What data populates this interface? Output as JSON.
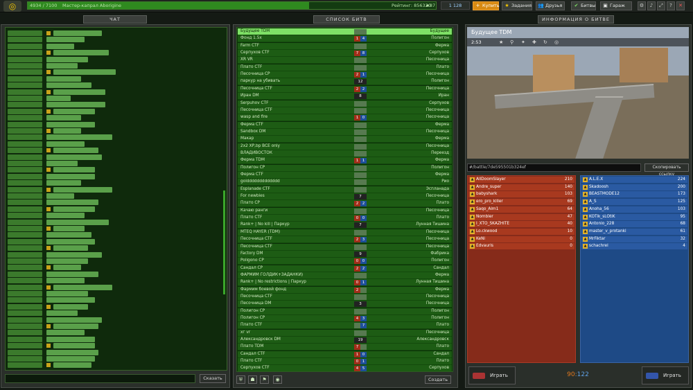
{
  "topbar": {
    "rank_progress_text": "4934 / 7100",
    "rank_name": "Мастер-капрал Aborigine",
    "rank_progress": 0.69,
    "rating_text": "Рейтинг: 856320",
    "rating_star": "★87",
    "crystals": "1 128",
    "buy_label": "Купить",
    "missions_label": "Задания",
    "friends_label": "Друзья",
    "battles_label": "Битвы",
    "garage_label": "Гараж"
  },
  "chat": {
    "title": "ЧАТ",
    "send_label": "Сказать"
  },
  "battles": {
    "title": "СПИСОК БИТВ",
    "create_label": "Создать",
    "rows": [
      {
        "name": "Будущее TDM",
        "map": "Будущее",
        "red": "",
        "blue": "",
        "mode": "team",
        "selected": true
      },
      {
        "name": "Фонд 1.5x",
        "map": "Полигон",
        "red": "1",
        "blue": "4",
        "mode": "team"
      },
      {
        "name": "Farm CTF",
        "map": "Ферма",
        "red": "",
        "blue": "",
        "mode": "team"
      },
      {
        "name": "Серпухов CTF",
        "map": "Серпухов",
        "red": "7",
        "blue": "8",
        "mode": "team"
      },
      {
        "name": "XR VR",
        "map": "Песочница",
        "red": "",
        "blue": "",
        "mode": "team"
      },
      {
        "name": "Плато CTF",
        "map": "Плато",
        "red": "",
        "blue": "",
        "mode": "team"
      },
      {
        "name": "Песочница CP",
        "map": "Песочница",
        "red": "2",
        "blue": "1",
        "mode": "team"
      },
      {
        "name": "паркур на убивать",
        "map": "Полигон",
        "dm": "12",
        "mode": "dm"
      },
      {
        "name": "Песочница CTF",
        "map": "Песочница",
        "red": "2",
        "blue": "2",
        "mode": "team"
      },
      {
        "name": "Иран DM",
        "map": "Иран",
        "dm": "8",
        "mode": "dm"
      },
      {
        "name": "Serpuhov CTF",
        "map": "Серпухов",
        "red": "",
        "blue": "",
        "mode": "team"
      },
      {
        "name": "Песочница CTF",
        "map": "Песочница",
        "red": "",
        "blue": "",
        "mode": "team"
      },
      {
        "name": "wasp and fire",
        "map": "Песочница",
        "red": "1",
        "blue": "0",
        "mode": "team"
      },
      {
        "name": "Ферма CTF",
        "map": "Ферма",
        "red": "",
        "blue": "",
        "mode": "team"
      },
      {
        "name": "Sandbox DM",
        "map": "Песочница",
        "dm": "",
        "mode": "dm"
      },
      {
        "name": "Макар",
        "map": "Ферма",
        "red": "",
        "blue": "",
        "mode": "team"
      },
      {
        "name": "2x2 XP,bp ВСЕ only",
        "map": "Песочница",
        "red": "",
        "blue": "",
        "mode": "team"
      },
      {
        "name": "ВЛАДИВОСТОК",
        "map": "Переезд",
        "red": "",
        "blue": "",
        "mode": "team"
      },
      {
        "name": "Ферма TDM",
        "map": "Ферма",
        "red": "1",
        "blue": "1",
        "mode": "team"
      },
      {
        "name": "Полигон CP",
        "map": "Полигон",
        "red": "",
        "blue": "",
        "mode": "team"
      },
      {
        "name": "Ферма CTF",
        "map": "Ферма",
        "red": "",
        "blue": "",
        "mode": "team"
      },
      {
        "name": "golddddddddddddd",
        "map": "Рио",
        "dm": "",
        "mode": "dm"
      },
      {
        "name": "Esplanade CTF",
        "map": "Эспланада",
        "red": "",
        "blue": "",
        "mode": "team"
      },
      {
        "name": "For newbies",
        "map": "Песочница",
        "dm": "7",
        "mode": "dm"
      },
      {
        "name": "Плато CP",
        "map": "Плато",
        "red": "2",
        "blue": "2",
        "mode": "team"
      },
      {
        "name": "Качаю ранги",
        "map": "Песочница",
        "red": "",
        "blue": "",
        "mode": "team"
      },
      {
        "name": "Плато CTF",
        "map": "Плато",
        "red": "0",
        "blue": "0",
        "mode": "team"
      },
      {
        "name": "Rank+ | No kill | Паркур",
        "map": "Лунная Тишина",
        "dm": "7",
        "mode": "dm"
      },
      {
        "name": "MTEQ HAYER (TDM)",
        "map": "Песочница",
        "red": "",
        "blue": "",
        "mode": "team"
      },
      {
        "name": "Песочница CTF",
        "map": "Песочница",
        "red": "2",
        "blue": "3",
        "mode": "team"
      },
      {
        "name": "Песочница CTF",
        "map": "Песочница",
        "red": "",
        "blue": "",
        "mode": "team"
      },
      {
        "name": "Factory DM",
        "map": "Фабрика",
        "dm": "9",
        "mode": "dm"
      },
      {
        "name": "Poligono CP",
        "map": "Полигон",
        "red": "0",
        "blue": "0",
        "mode": "team"
      },
      {
        "name": "Сандал CP",
        "map": "Сандал",
        "red": "2",
        "blue": "2",
        "mode": "team"
      },
      {
        "name": "ФАРМИМ ГОЛДИК+ЗАДАНКИ)",
        "map": "Ферма",
        "red": "",
        "blue": "",
        "mode": "team"
      },
      {
        "name": "Rank+ | No restrictions | Паркур",
        "map": "Лунная Тишина",
        "red": "0",
        "blue": "1",
        "mode": "team"
      },
      {
        "name": "Фармим боевой фонд",
        "map": "Ферма",
        "red": "2",
        "blue": "",
        "mode": "team"
      },
      {
        "name": "Песочница CTF",
        "map": "Песочница",
        "red": "",
        "blue": "",
        "mode": "team"
      },
      {
        "name": "Песочница DM",
        "map": "Песочница",
        "dm": "3",
        "mode": "dm"
      },
      {
        "name": "Полигон CP",
        "map": "Полигон",
        "red": "",
        "blue": "",
        "mode": "team"
      },
      {
        "name": "Полигон CP",
        "map": "Полигон",
        "red": "4",
        "blue": "3",
        "mode": "team"
      },
      {
        "name": "Плато CTF",
        "map": "Плато",
        "red": "",
        "blue": "7",
        "mode": "team"
      },
      {
        "name": "хг vr",
        "map": "Песочница",
        "red": "",
        "blue": "",
        "mode": "team"
      },
      {
        "name": "Александровск DM",
        "map": "Александровск",
        "dm": "19",
        "mode": "dm"
      },
      {
        "name": "Плато TDM",
        "map": "Плато",
        "red": "7",
        "blue": "",
        "mode": "team"
      },
      {
        "name": "Сандал CTF",
        "map": "Сандал",
        "red": "1",
        "blue": "0",
        "mode": "team"
      },
      {
        "name": "Плато CTF",
        "map": "Плато",
        "red": "0",
        "blue": "1",
        "mode": "team"
      },
      {
        "name": "Серпухов CTF",
        "map": "Серпухов",
        "red": "4",
        "blue": "5",
        "mode": "team"
      }
    ]
  },
  "info": {
    "title": "ИНФОРМАЦИЯ О БИТВЕ",
    "map_name": "Будущее TDM",
    "timer": "2:53",
    "link": "#/battle/7de595501b324ef",
    "copy_label": "Скопировать ссылку",
    "red_team": [
      {
        "name": "AllDoomSlayer",
        "score": "210"
      },
      {
        "name": "Andre_super",
        "score": "140"
      },
      {
        "name": "babyshark",
        "score": "103"
      },
      {
        "name": "ero_pro_killer",
        "score": "69"
      },
      {
        "name": "Saqo_Aim1",
        "score": "64"
      },
      {
        "name": "Nombler",
        "score": "47"
      },
      {
        "name": "I_XTO_SKAZHITE",
        "score": "40"
      },
      {
        "name": "Lo.ckwood",
        "score": "10"
      },
      {
        "name": "KeNi",
        "score": "0"
      },
      {
        "name": "Edvauris",
        "score": "0"
      }
    ],
    "blue_team": [
      {
        "name": "A.L.E.X",
        "score": "224"
      },
      {
        "name": "Skadoosh",
        "score": "200"
      },
      {
        "name": "BEASTMODE12",
        "score": "173"
      },
      {
        "name": "A_S",
        "score": "125"
      },
      {
        "name": "Anoha_56",
        "score": "103"
      },
      {
        "name": "KOTik_sLOtiK",
        "score": "95"
      },
      {
        "name": "Antonio_228",
        "score": "68"
      },
      {
        "name": "master_v_protanki",
        "score": "61"
      },
      {
        "name": "MrFiktar",
        "score": "32"
      },
      {
        "name": "schachrel",
        "score": "4"
      }
    ],
    "play_label": "Играть",
    "score_red": "90",
    "score_blue": "122"
  },
  "colors": {
    "accent": "#7ee066",
    "red_team": "#862b1a",
    "blue_team": "#1e4a86",
    "buy": "#d88a12"
  }
}
